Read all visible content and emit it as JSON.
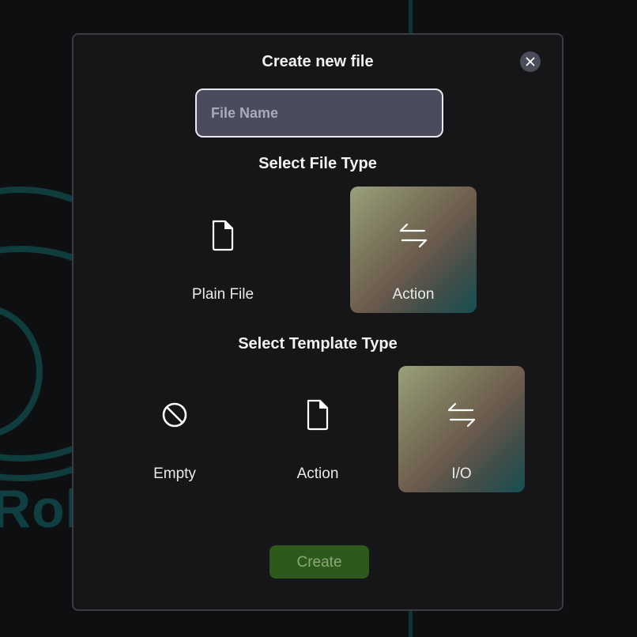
{
  "background": {
    "logo_text": "Rob"
  },
  "modal": {
    "title": "Create new file",
    "close_icon": "close-icon",
    "file_name": {
      "value": "",
      "placeholder": "File Name"
    },
    "file_type": {
      "heading": "Select File Type",
      "options": [
        {
          "label": "Plain File",
          "icon": "file-icon",
          "selected": false
        },
        {
          "label": "Action",
          "icon": "arrows-exchange-icon",
          "selected": true
        }
      ]
    },
    "template_type": {
      "heading": "Select Template Type",
      "options": [
        {
          "label": "Empty",
          "icon": "ban-icon",
          "selected": false
        },
        {
          "label": "Action",
          "icon": "file-icon",
          "selected": false
        },
        {
          "label": "I/O",
          "icon": "arrows-exchange-icon",
          "selected": true
        }
      ]
    },
    "create_label": "Create"
  },
  "colors": {
    "accent_selected_start": "#9aa07c",
    "accent_selected_end": "#164f53",
    "create_button": "#2d5a1a",
    "create_text": "#8aa87a",
    "modal_bg": "#161619"
  }
}
